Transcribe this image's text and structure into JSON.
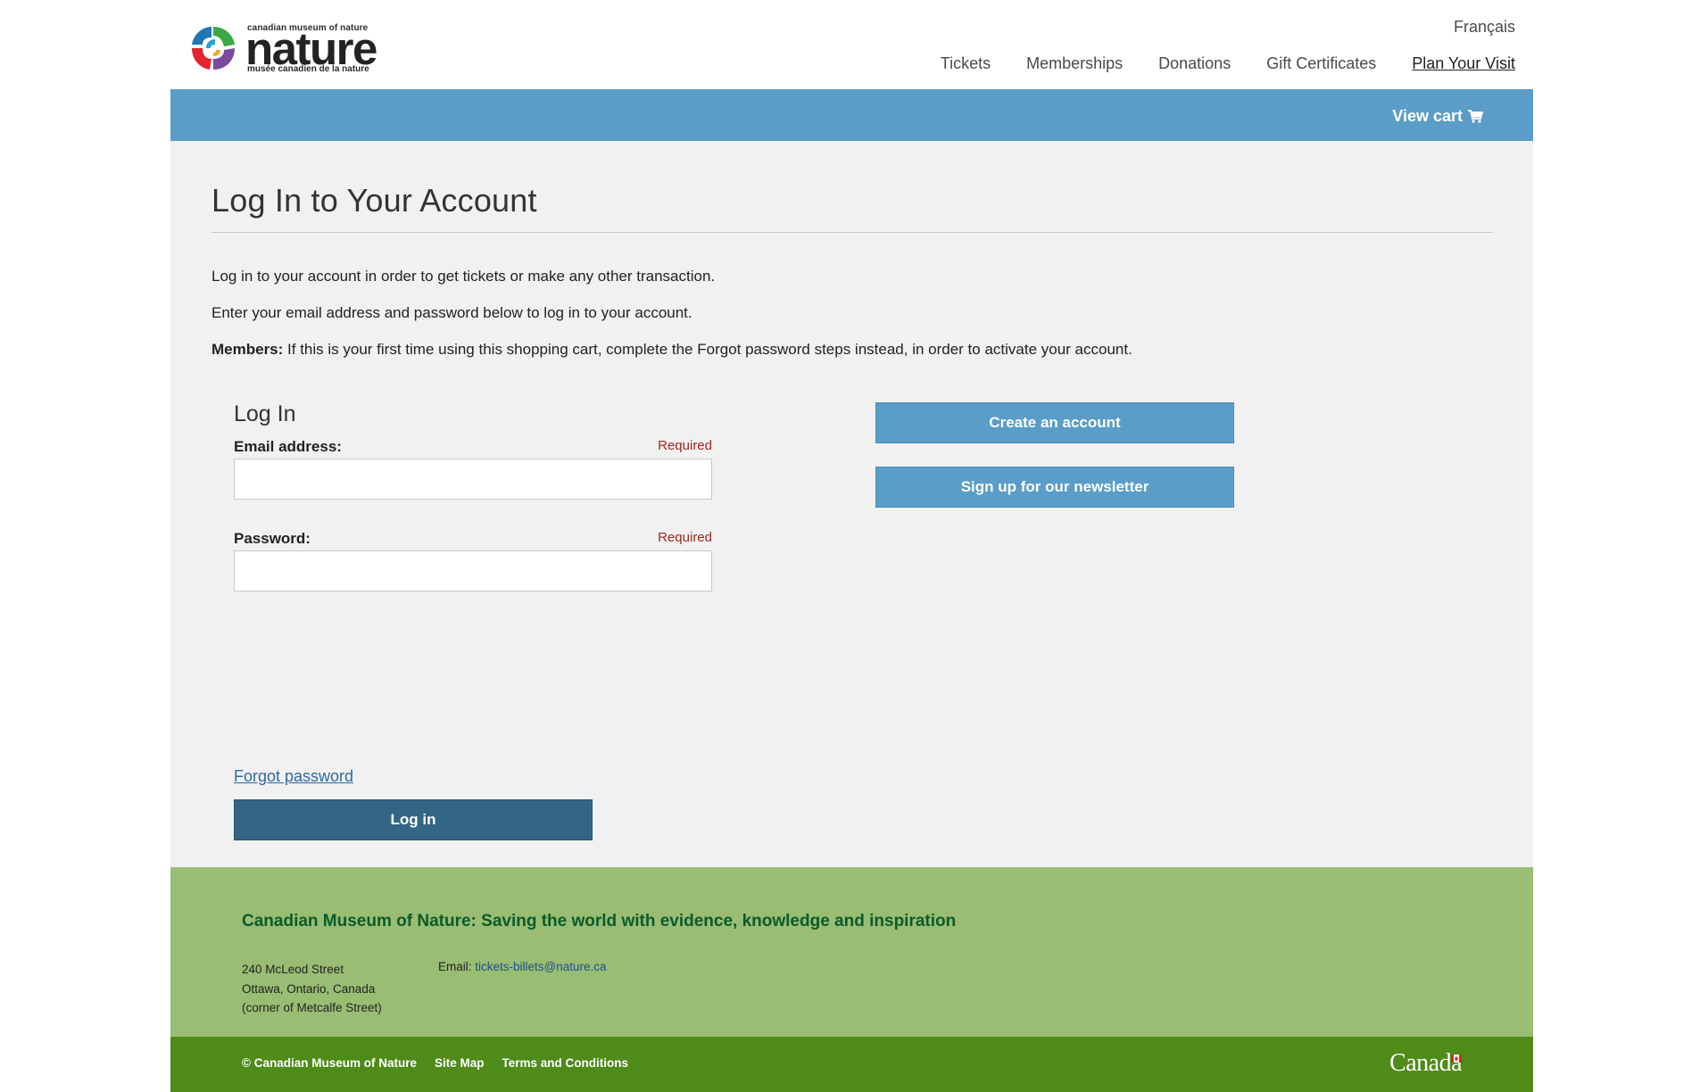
{
  "header": {
    "logo": {
      "small_top": "canadian museum of nature",
      "word": "nature",
      "small_bottom": "musée canadien de la nature"
    },
    "language_link": "Français",
    "nav": [
      {
        "label": "Tickets"
      },
      {
        "label": "Memberships"
      },
      {
        "label": "Donations"
      },
      {
        "label": "Gift Certificates"
      },
      {
        "label": "Plan Your Visit",
        "active": true
      }
    ]
  },
  "cart_bar": {
    "view_cart_label": "View cart",
    "icon": "shopping-cart-icon"
  },
  "main": {
    "title": "Log In to Your Account",
    "intro_line_1": "Log in to your account in order to get tickets or make any other transaction.",
    "intro_line_2": "Enter your email address and password below to log in to your account.",
    "members_label": "Members:",
    "members_text": " If this is your first time using this shopping cart, complete the Forgot password steps instead, in order to activate your account.",
    "login": {
      "heading": "Log In",
      "email_label": "Email address:",
      "email_required": "Required",
      "email_value": "",
      "password_label": "Password:",
      "password_required": "Required",
      "password_value": "",
      "forgot_link": "Forgot password",
      "submit_label": "Log in"
    },
    "side_buttons": {
      "create_account": "Create an account",
      "newsletter": "Sign up for our newsletter"
    }
  },
  "footer": {
    "tagline": "Canadian Museum of Nature: Saving the world with evidence, knowledge and inspiration",
    "address_line_1": "240 McLeod Street",
    "address_line_2": "Ottawa, Ontario, Canada",
    "address_line_3": "(corner of Metcalfe Street)",
    "email_label": "Email: ",
    "email_address": "tickets-billets@nature.ca",
    "copyright": "© Canadian Museum of Nature",
    "site_map": "Site Map",
    "terms": "Terms and Conditions",
    "canada_wordmark": "Canada"
  },
  "colors": {
    "cart_bar": "#599dc8",
    "login_button": "#336684",
    "footer_top": "#99bd73",
    "footer_bottom": "#4e8b18",
    "tagline": "#0a5b2c",
    "required": "#a1261d",
    "link": "#2f6aa1"
  }
}
